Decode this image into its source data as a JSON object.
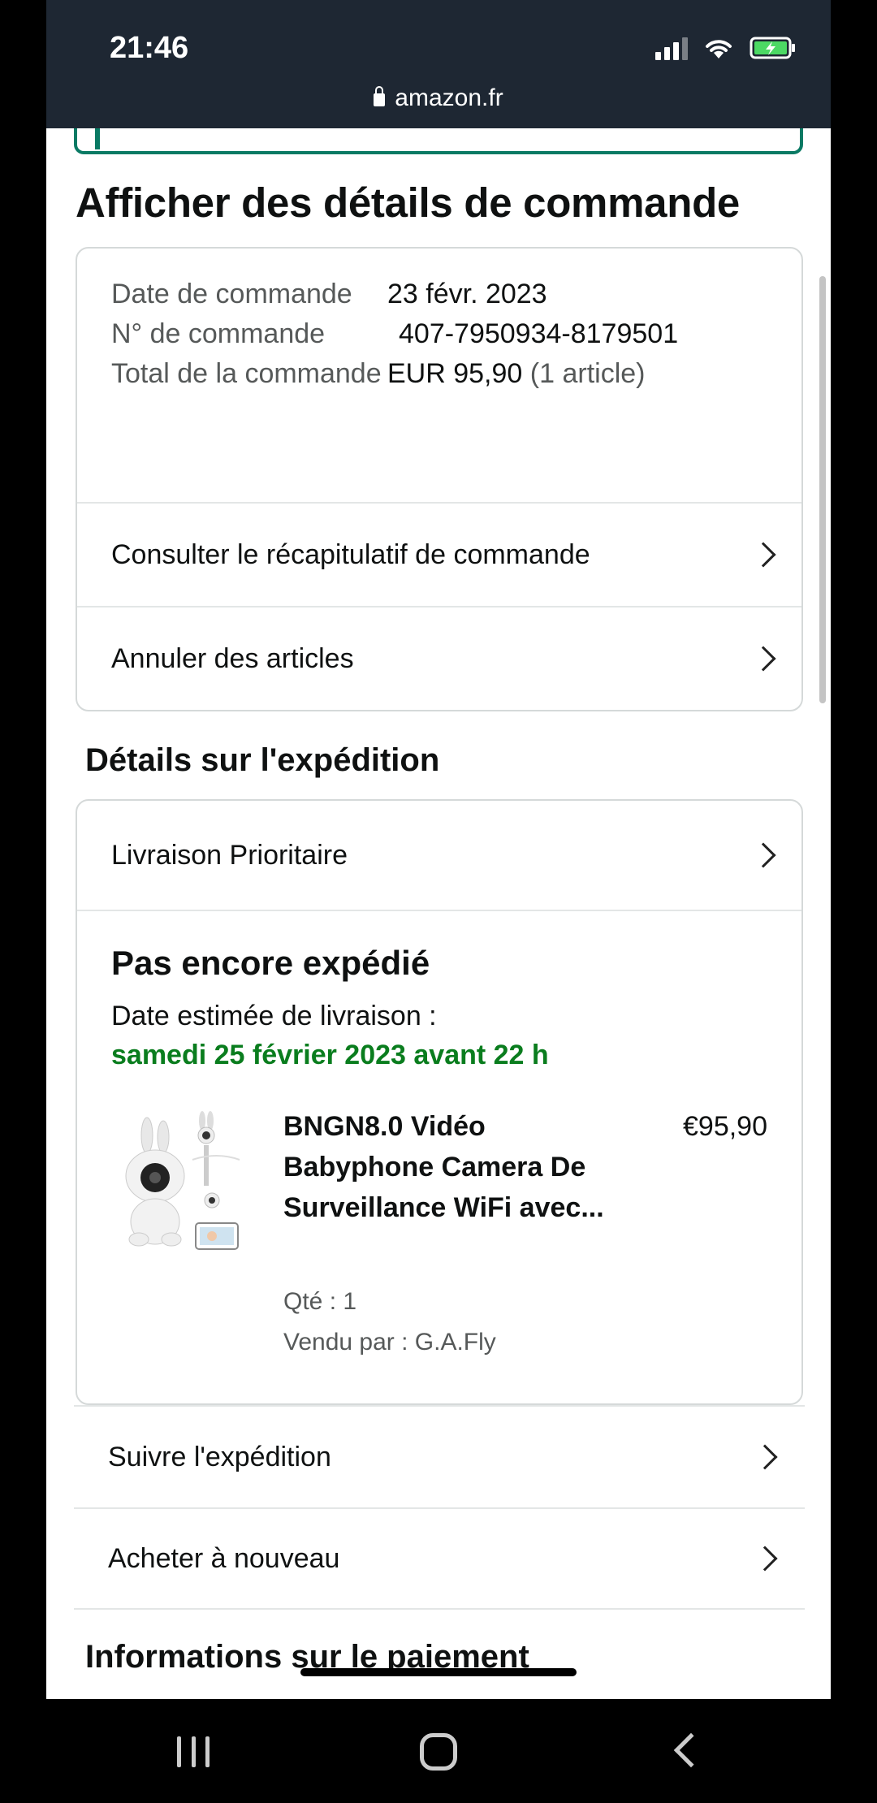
{
  "status_bar": {
    "time": "21:46",
    "url": "amazon.fr",
    "icons": [
      "signal-icon",
      "wifi-icon",
      "battery-charging-icon"
    ]
  },
  "page": {
    "title": "Afficher des détails de commande",
    "order_info": {
      "date_label": "Date de commande",
      "date_value": "23 févr. 2023",
      "number_label": "N° de commande",
      "number_value": "407-7950934-8179501",
      "total_label": "Total de la commande",
      "total_value": "EUR 95,90",
      "total_count": "(1 article)"
    },
    "links": {
      "summary": "Consulter le récapitulatif de commande",
      "cancel": "Annuler des articles"
    },
    "shipping": {
      "section_title": "Détails sur l'expédition",
      "method": "Livraison Prioritaire",
      "status": "Pas encore expédié",
      "eta_label": "Date estimée de livraison :",
      "eta_date": "samedi 25 février 2023 avant 22 h",
      "product": {
        "name": "BNGN8.0 Vidéo Babyphone Camera De Surveillance WiFi avec...",
        "price": "€95,90",
        "qty": "Qté : 1",
        "seller": "Vendu par : G.A.Fly"
      }
    },
    "actions": {
      "track": "Suivre l'expédition",
      "buy_again": "Acheter à nouveau"
    },
    "payment_section_title": "Informations sur le paiement"
  },
  "colors": {
    "status_bar_bg": "#1e2733",
    "eta_green": "#0a7d1e",
    "border": "#d5d9d9"
  }
}
